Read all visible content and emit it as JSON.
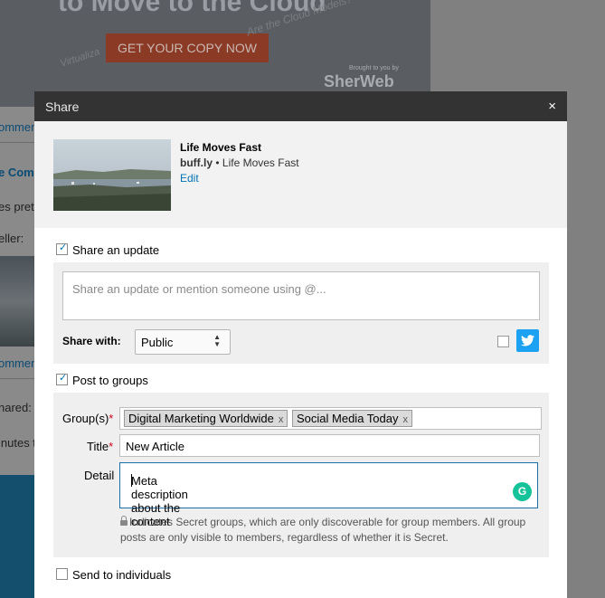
{
  "background": {
    "banner_title": "to Move to the Cloud",
    "banner_button": "GET YOUR COPY NOW",
    "banner_text_left": "Virtualiza",
    "banner_text_right": "Are the Cloud Models?",
    "banner_brand": "SherWeb",
    "banner_brand_caption": "Brought to you by",
    "fragments": [
      "ommen",
      "e Com",
      "es prett",
      "eller:",
      "ommen",
      "hared:",
      "inutes t"
    ]
  },
  "modal": {
    "title": "Share",
    "close": "×",
    "preview": {
      "title": "Life Moves Fast",
      "source_domain": "buff.ly",
      "separator": "•",
      "source_title": "Life Moves Fast",
      "edit": "Edit"
    },
    "share_update": {
      "label": "Share an update",
      "checked": true,
      "placeholder": "Share an update or mention someone using @...",
      "share_with_label": "Share with:",
      "share_with_value": "Public",
      "twitter_checked": false,
      "twitter_icon": "twitter-bird-icon"
    },
    "post_groups": {
      "label": "Post to groups",
      "checked": true,
      "groups_label": "Group(s)",
      "groups": [
        "Digital Marketing Worldwide",
        "Social Media Today"
      ],
      "tag_remove": "x",
      "title_label": "Title",
      "title_value": "New Article",
      "detail_label": "Detail",
      "detail_value": "Meta description about the content",
      "required_mark": "*",
      "note": "Indicates Secret groups, which are only discoverable for group members. All group posts are only visible to members, regardless of whether it is Secret.",
      "grammarly": "G"
    },
    "send_individuals": {
      "label": "Send to individuals",
      "checked": false
    }
  },
  "colors": {
    "header_bg": "#333333",
    "link": "#0073b1",
    "twitter": "#1da1f2",
    "required": "#d0021b",
    "grammarly": "#15c39a"
  }
}
